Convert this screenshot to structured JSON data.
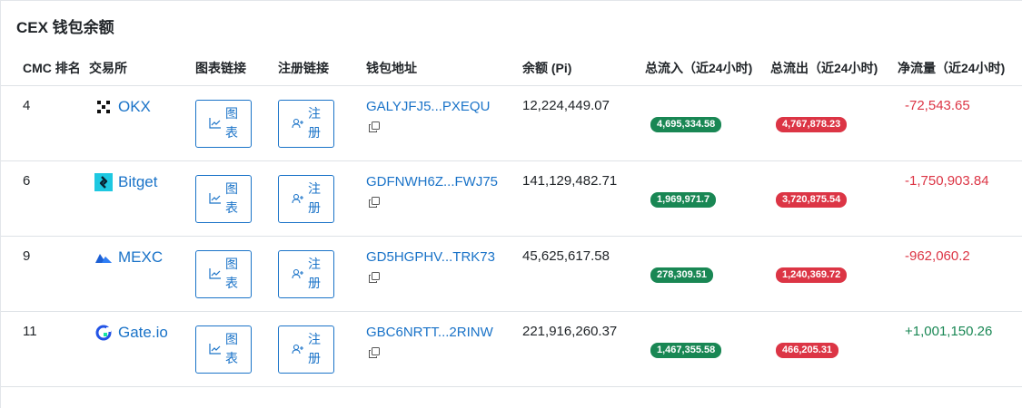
{
  "title": "CEX 钱包余额",
  "headers": {
    "rank": "CMC 排名",
    "exchange": "交易所",
    "chart_link": "图表链接",
    "register_link": "注册链接",
    "wallet": "钱包地址",
    "balance": "余额 (Pi)",
    "inflow": "总流入（近24小时)",
    "outflow": "总流出（近24小时)",
    "net": "净流量（近24小时)"
  },
  "buttons": {
    "chart": "图表",
    "register": "注册"
  },
  "colors": {
    "accent": "#1a73c8",
    "positive": "#198754",
    "negative": "#dc3545"
  },
  "rows": [
    {
      "rank": "4",
      "exchange": "OKX",
      "logo": "okx-icon",
      "wallet": "GALYJFJ5...PXEQU",
      "balance": "12,224,449.07",
      "inflow": "4,695,334.58",
      "outflow": "4,767,878.23",
      "net": "-72,543.65",
      "net_sign": "negative"
    },
    {
      "rank": "6",
      "exchange": "Bitget",
      "logo": "bitget-icon",
      "wallet": "GDFNWH6Z...FWJ75",
      "balance": "141,129,482.71",
      "inflow": "1,969,971.7",
      "outflow": "3,720,875.54",
      "net": "-1,750,903.84",
      "net_sign": "negative"
    },
    {
      "rank": "9",
      "exchange": "MEXC",
      "logo": "mexc-icon",
      "wallet": "GD5HGPHV...TRK73",
      "balance": "45,625,617.58",
      "inflow": "278,309.51",
      "outflow": "1,240,369.72",
      "net": "-962,060.2",
      "net_sign": "negative"
    },
    {
      "rank": "11",
      "exchange": "Gate.io",
      "logo": "gateio-icon",
      "wallet": "GBC6NRTT...2RINW",
      "balance": "221,916,260.37",
      "inflow": "1,467,355.58",
      "outflow": "466,205.31",
      "net": "+1,001,150.26",
      "net_sign": "positive"
    }
  ]
}
